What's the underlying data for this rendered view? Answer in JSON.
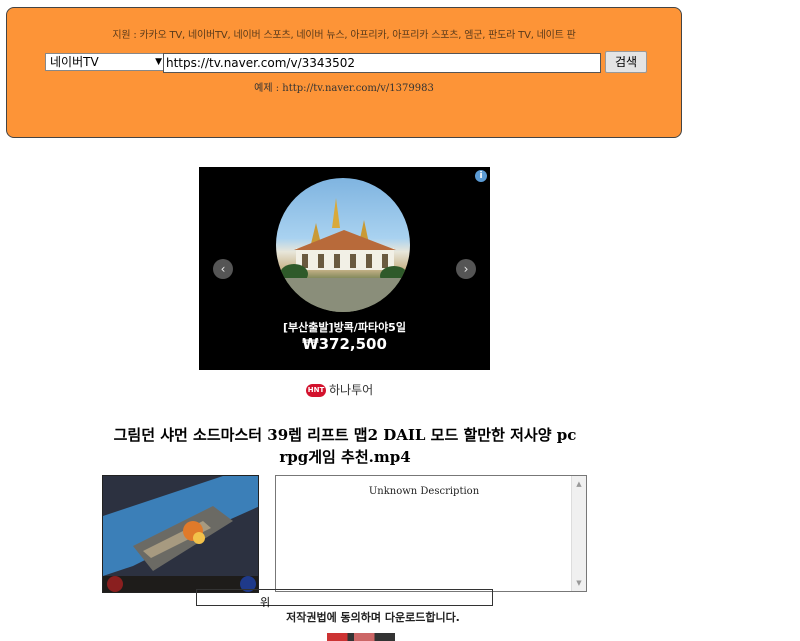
{
  "search": {
    "supported_sites": "지원 : 카카오 TV, 네이버TV, 네이버 스포츠, 네이버 뉴스, 아프리카, 아프리카 스포츠, 엠군, 판도라 TV, 네이트 판",
    "site_select_value": "네이버TV",
    "url_value": "https://tv.naver.com/v/3343502",
    "button_label": "검색",
    "example": "예제 : http://tv.naver.com/v/1379983"
  },
  "ad": {
    "caption": "[부산출발]방콕/파타야5일",
    "price": "₩372,500",
    "info_label": "i",
    "prev_icon": "chevron-left-icon",
    "next_icon": "chevron-right-icon",
    "brand_logo": "HNT",
    "brand_name": "하나투어"
  },
  "video": {
    "title": "그림던 샤먼 소드마스터 39렙 리프트 맵2 DAIL 모드 할만한 저사양 pc rpg게임 추천.mp4",
    "description": "Unknown Description",
    "sub_label": "위",
    "agree_text": "저작권법에 동의하며 다운로드합니다."
  },
  "colors": {
    "panel": "#fd9437",
    "brand_red": "#d3122d"
  }
}
